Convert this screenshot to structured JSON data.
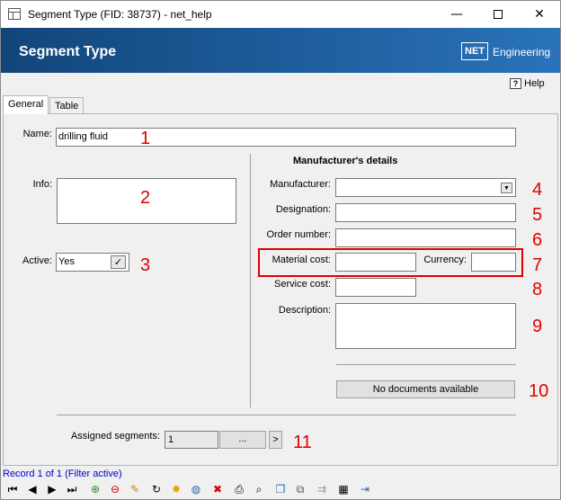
{
  "window": {
    "title": "Segment Type (FID: 38737) - net_help",
    "minimize_glyph": "—",
    "close_glyph": "✕"
  },
  "banner": {
    "heading": "Segment Type",
    "logo_box": "NET",
    "logo_text": "Engineering"
  },
  "help": {
    "icon": "?",
    "label": "Help"
  },
  "tabs": [
    {
      "label": "General",
      "active": true
    },
    {
      "label": "Table",
      "active": false
    }
  ],
  "form": {
    "name_label": "Name:",
    "name_value": "drilling fluid",
    "info_label": "Info:",
    "info_value": "",
    "active_label": "Active:",
    "active_value": "Yes",
    "active_checked": "✓",
    "manufacturer_section_title": "Manufacturer's details",
    "manufacturer_label": "Manufacturer:",
    "manufacturer_value": "",
    "combo_arrow": "▼",
    "designation_label": "Designation:",
    "designation_value": "",
    "order_number_label": "Order number:",
    "order_number_value": "",
    "material_cost_label": "Material cost:",
    "material_cost_value": "",
    "currency_label": "Currency:",
    "currency_value": "",
    "service_cost_label": "Service cost:",
    "service_cost_value": "",
    "description_label": "Description:",
    "description_value": "",
    "documents_button": "No documents available",
    "assigned_segments_label": "Assigned segments:",
    "assigned_segments_value": "1",
    "assigned_segments_browse": "...",
    "assigned_segments_go": ">"
  },
  "annotations": [
    "1",
    "2",
    "3",
    "4",
    "5",
    "6",
    "7",
    "8",
    "9",
    "10",
    "11"
  ],
  "status": {
    "record_info": "Record 1 of 1 (Filter active)"
  },
  "nav_icons": [
    "first-record-icon",
    "previous-record-icon",
    "next-record-icon",
    "last-record-icon",
    "add-filter-icon",
    "remove-filter-icon",
    "edit-icon",
    "refresh-icon",
    "new-record-icon",
    "globe-icon",
    "delete-icon",
    "print-icon",
    "search-icon",
    "copy-icon",
    "duplicate-icon",
    "link-icon",
    "table-edit-icon",
    "exit-icon"
  ],
  "colors": {
    "banner_start": "#12457a",
    "banner_end": "#2a73ba",
    "annotation_red": "#e00000",
    "record_info_blue": "#0000cc"
  }
}
